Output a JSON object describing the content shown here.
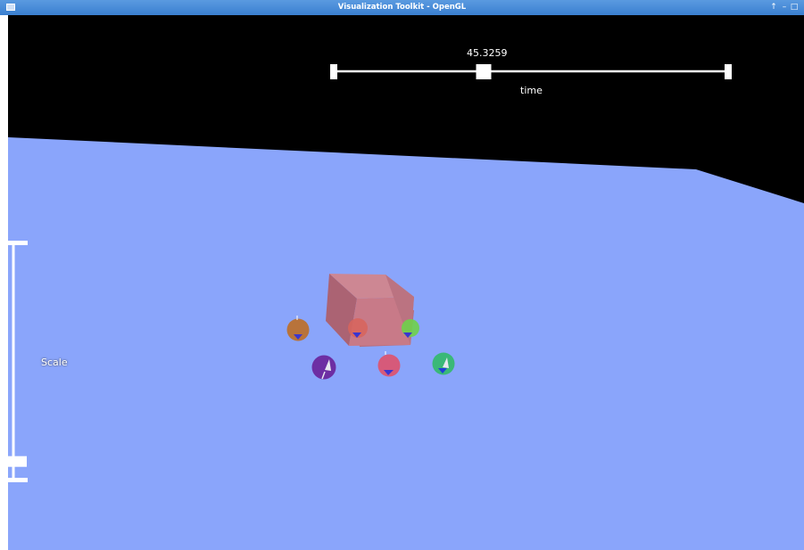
{
  "window": {
    "title": "Visualization Toolkit - OpenGL",
    "controls": {
      "maximize_glyph": "↑",
      "minimize_glyph": "–",
      "restore_glyph": "□",
      "close_glyph": "×"
    }
  },
  "time_slider": {
    "value_text": "45.3259",
    "title": "time",
    "position_fraction": 0.38
  },
  "scale_slider": {
    "title": "Scale",
    "position_fraction": 0.92
  },
  "colors": {
    "background": "#000000",
    "ground": "#8aa5fb",
    "widget": "#ffffff",
    "titlebar": "#3a7fd0",
    "cube": "#d9716a"
  },
  "spheres": [
    {
      "name": "orange",
      "color": "#b8733b"
    },
    {
      "name": "red",
      "color": "#d8645c"
    },
    {
      "name": "green",
      "color": "#6ed24a"
    },
    {
      "name": "purple",
      "color": "#6d2ea3"
    },
    {
      "name": "pink",
      "color": "#d65a7a"
    },
    {
      "name": "teal",
      "color": "#3ab878"
    }
  ]
}
